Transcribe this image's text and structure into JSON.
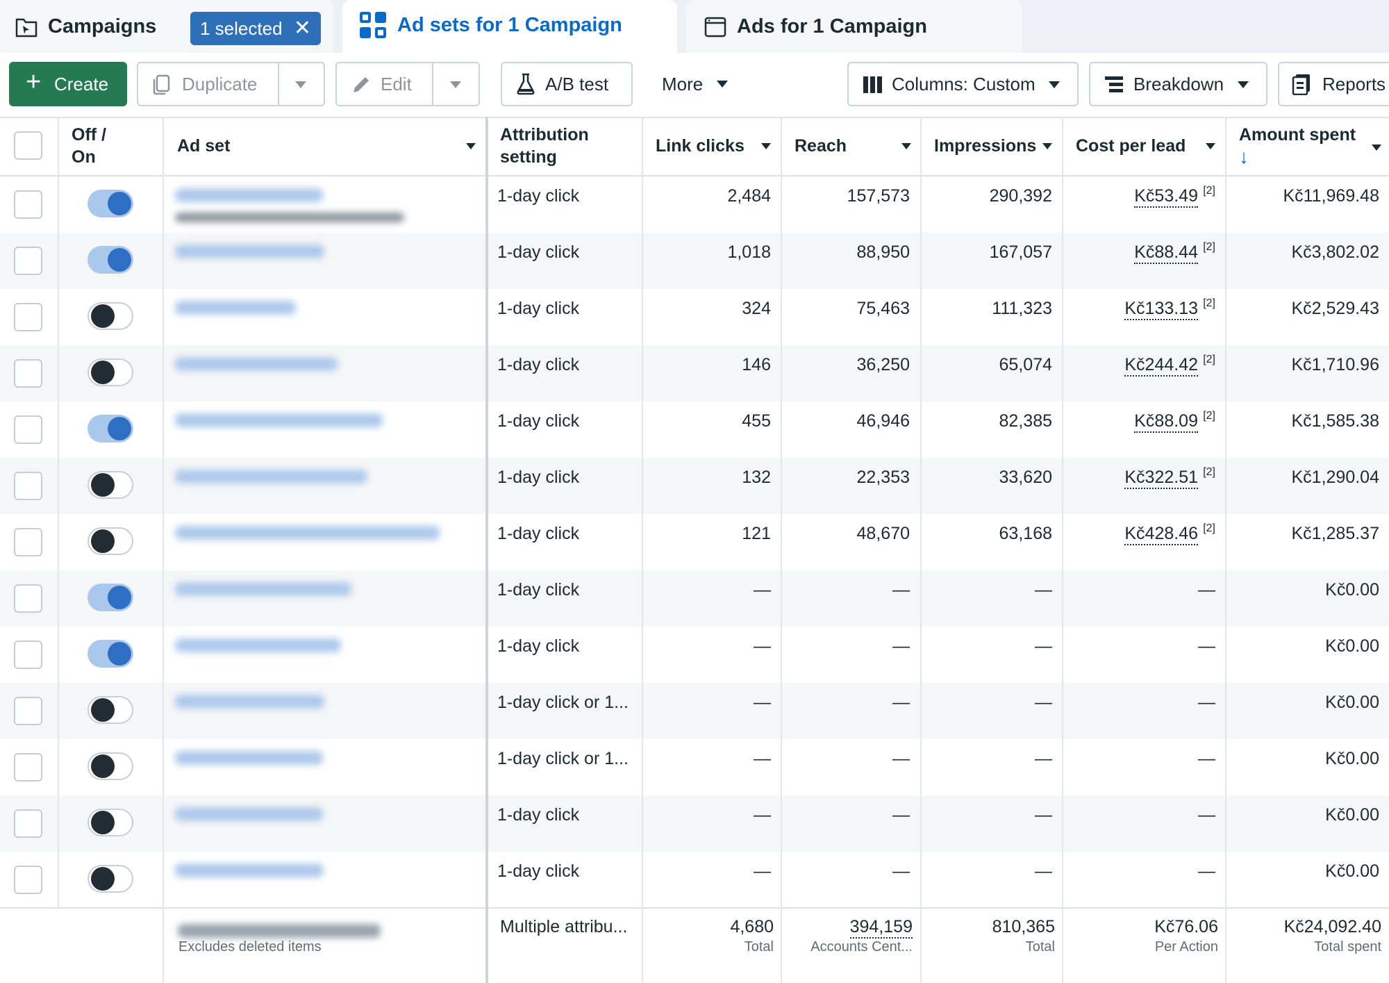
{
  "tabs": {
    "campaigns": {
      "label": "Campaigns",
      "selected_label": "1 selected",
      "clear": "✕"
    },
    "adsets": {
      "label": "Ad sets for 1 Campaign"
    },
    "ads": {
      "label": "Ads for 1 Campaign"
    }
  },
  "toolbar": {
    "create": "Create",
    "duplicate": "Duplicate",
    "edit": "Edit",
    "ab_test": "A/B test",
    "more": "More",
    "columns": "Columns: Custom",
    "breakdown": "Breakdown",
    "reports": "Reports"
  },
  "colors": {
    "accent": "#0a6acb",
    "create": "#267a52",
    "toggle_on": "#2e6fc4",
    "selected_pill": "#2d6fb8"
  },
  "table": {
    "headers": {
      "off_on": "Off / On",
      "ad_set": "Ad set",
      "attribution": "Attribution setting",
      "link_clicks": "Link clicks",
      "reach": "Reach",
      "impressions": "Impressions",
      "cost_per_lead": "Cost per lead",
      "amount_spent": "Amount spent",
      "sort_icon": "↓"
    },
    "rows": [
      {
        "on": true,
        "attribution": "1-day click",
        "link_clicks": "2,484",
        "reach": "157,573",
        "impressions": "290,392",
        "cost_per_lead": "Kč53.49",
        "note": "[2]",
        "amount": "Kč11,969.48"
      },
      {
        "on": true,
        "attribution": "1-day click",
        "link_clicks": "1,018",
        "reach": "88,950",
        "impressions": "167,057",
        "cost_per_lead": "Kč88.44",
        "note": "[2]",
        "amount": "Kč3,802.02"
      },
      {
        "on": false,
        "attribution": "1-day click",
        "link_clicks": "324",
        "reach": "75,463",
        "impressions": "111,323",
        "cost_per_lead": "Kč133.13",
        "note": "[2]",
        "amount": "Kč2,529.43"
      },
      {
        "on": false,
        "attribution": "1-day click",
        "link_clicks": "146",
        "reach": "36,250",
        "impressions": "65,074",
        "cost_per_lead": "Kč244.42",
        "note": "[2]",
        "amount": "Kč1,710.96"
      },
      {
        "on": true,
        "attribution": "1-day click",
        "link_clicks": "455",
        "reach": "46,946",
        "impressions": "82,385",
        "cost_per_lead": "Kč88.09",
        "note": "[2]",
        "amount": "Kč1,585.38"
      },
      {
        "on": false,
        "attribution": "1-day click",
        "link_clicks": "132",
        "reach": "22,353",
        "impressions": "33,620",
        "cost_per_lead": "Kč322.51",
        "note": "[2]",
        "amount": "Kč1,290.04"
      },
      {
        "on": false,
        "attribution": "1-day click",
        "link_clicks": "121",
        "reach": "48,670",
        "impressions": "63,168",
        "cost_per_lead": "Kč428.46",
        "note": "[2]",
        "amount": "Kč1,285.37"
      },
      {
        "on": true,
        "attribution": "1-day click",
        "link_clicks": "—",
        "reach": "—",
        "impressions": "—",
        "cost_per_lead": "—",
        "note": "",
        "amount": "Kč0.00"
      },
      {
        "on": true,
        "attribution": "1-day click",
        "link_clicks": "—",
        "reach": "—",
        "impressions": "—",
        "cost_per_lead": "—",
        "note": "",
        "amount": "Kč0.00"
      },
      {
        "on": false,
        "attribution": "1-day click or 1...",
        "link_clicks": "—",
        "reach": "—",
        "impressions": "—",
        "cost_per_lead": "—",
        "note": "",
        "amount": "Kč0.00"
      },
      {
        "on": false,
        "attribution": "1-day click or 1...",
        "link_clicks": "—",
        "reach": "—",
        "impressions": "—",
        "cost_per_lead": "—",
        "note": "",
        "amount": "Kč0.00"
      },
      {
        "on": false,
        "attribution": "1-day click",
        "link_clicks": "—",
        "reach": "—",
        "impressions": "—",
        "cost_per_lead": "—",
        "note": "",
        "amount": "Kč0.00"
      },
      {
        "on": false,
        "attribution": "1-day click",
        "link_clicks": "—",
        "reach": "—",
        "impressions": "—",
        "cost_per_lead": "—",
        "note": "",
        "amount": "Kč0.00"
      }
    ],
    "totals": {
      "excludes": "Excludes deleted items",
      "attribution": "Multiple attribu...",
      "link_clicks": "4,680",
      "link_clicks_sub": "Total",
      "reach": "394,159",
      "reach_sub": "Accounts Cent...",
      "impressions": "810,365",
      "impressions_sub": "Total",
      "cost_per_lead": "Kč76.06",
      "cost_per_lead_sub": "Per Action",
      "amount": "Kč24,092.40",
      "amount_sub": "Total spent"
    }
  }
}
